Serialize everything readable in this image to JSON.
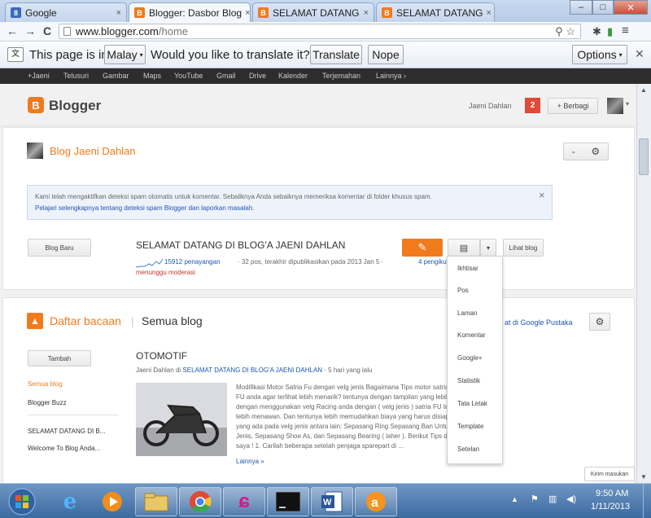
{
  "browser": {
    "tabs": [
      {
        "label": "Google",
        "icon": "google-icon",
        "active": false
      },
      {
        "label": "Blogger: Dasbor Blog",
        "icon": "blogger-icon",
        "active": true
      },
      {
        "label": "SELAMAT DATANG",
        "icon": "blogger-icon",
        "active": false
      },
      {
        "label": "SELAMAT DATANG",
        "icon": "blogger-icon",
        "active": false
      }
    ],
    "tab_close": "×",
    "window_buttons": {
      "minimize": "–",
      "maximize": "□",
      "close": "✕"
    },
    "url_host": "www.blogger.com",
    "url_path": "/home",
    "nav": {
      "back": "←",
      "forward": "→",
      "reload": "C"
    }
  },
  "translate_bar": {
    "prefix": "This page is in",
    "language": "Malay",
    "question": "Would you like to translate it?",
    "translate_button": "Translate",
    "nope_button": "Nope",
    "options_button": "Options"
  },
  "google_bar": {
    "items": [
      "+Jaeni",
      "Telusuri",
      "Gambar",
      "Maps",
      "YouTube",
      "Gmail",
      "Drive",
      "Kalender",
      "Terjemahan",
      "Lainnya ›"
    ]
  },
  "blogger": {
    "logo_letter": "B",
    "brand": "Blogger",
    "user_name": "Jaeni Dahlan",
    "notification_count": "2",
    "share_button": "+ Berbagi",
    "blog_section": {
      "title": "Blog Jaeni Dahlan",
      "collapse": "-",
      "notice_line1": "Kami telah mengaktifkan deteksi spam otomatis untuk komentar. Sebaliknya Anda sebaiknya memeriksa komentar di folder khusus spam.",
      "notice_line2": "Pelajari selengkapnya tentang deteksi spam Blogger dan laporkan masalah.",
      "notice_close": "×",
      "new_post_button": "Blog Baru",
      "blog_title": "SELAMAT DATANG DI BLOG'A JAENI DAHLAN",
      "pageviews": "15912 penayangan",
      "stats_rest": "· 32 pos, terakhir dipublikasikan pada 2013 Jan 5 ·",
      "pending": "4 pengikut",
      "pending_line2": "menunggu moderasi",
      "view_blog_button": "Lihat blog"
    },
    "dropdown_items": [
      "Ikhtisar",
      "Pos",
      "Laman",
      "Komentar",
      "Google+",
      "Statistik",
      "Tata Letak",
      "Template",
      "Setelan"
    ],
    "reading_list": {
      "title": "Daftar bacaan",
      "separator": "|",
      "subtitle": "Semua blog",
      "add_button": "Tambah",
      "google_reader_link": "at di Google Pustaka",
      "sidebar_links": [
        "Semua blog",
        "Blogger Buzz",
        "SELAMAT DATANG DI B...",
        "Welcome To Blog Anda..."
      ],
      "post": {
        "title": "OTOMOTIF",
        "author": "Jaeni Dahlan",
        "in_word": "di",
        "blog_link": "SELAMAT DATANG DI BLOG'A JAENI DAHLAN",
        "time": "· 5 hari yang lalu",
        "snippet": [
          "Modifikasi Motor Satria Fu dengan velg jenis Bagaimana Tips motor satria",
          "FU anda agar terlihat lebih menarik? tentunya dengan tampilan yang lebih",
          "dengan menggunakan velg Racing anda dengan ( velg jenis ) satria FU terlihat",
          "lebih menawan. Dan tentunya lebih memudahkan biaya yang harus disiapkan",
          "yang ada pada velg jenis antara lain: Sepasang Ring Sepasang Ban Untuk",
          "Jenis, Sepasang Shoe As, dan Sepasang Bearing ( laher ). Berikut Tips dari",
          "saya ! 1. Carilah beberapa setelah penjaga sparepart di ..."
        ],
        "more_link": "Lainnya »"
      }
    },
    "report_button": "Kirim masukan"
  },
  "taskbar": {
    "time": "9:50 AM",
    "date": "1/11/2013",
    "apps": [
      "start-orb",
      "internet-explorer-icon",
      "media-player-icon",
      "file-explorer-icon",
      "chrome-icon",
      "picsart-icon",
      "terminal-icon",
      "word-icon",
      "avast-icon"
    ]
  },
  "colors": {
    "blogger_orange": "#f07b1d",
    "notification_red": "#dd4b39",
    "link_blue": "#1f55b3",
    "taskbar_blue": "#3c6aa1"
  }
}
